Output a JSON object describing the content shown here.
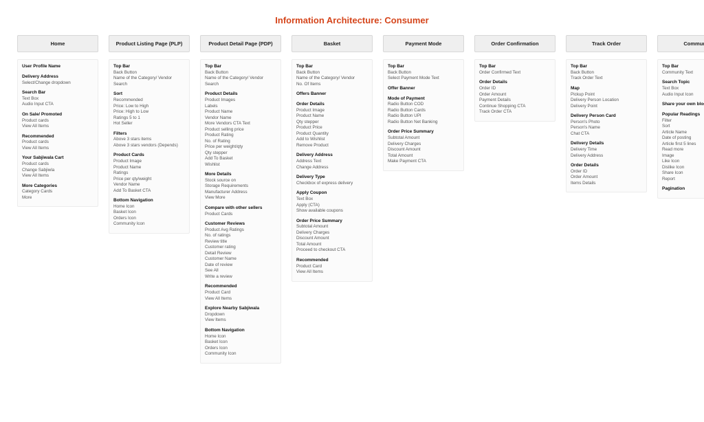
{
  "title": "Information Architecture: Consumer",
  "columns": [
    {
      "name": "home",
      "header": "Home",
      "groups": [
        {
          "title": "User Profile Name",
          "items": []
        },
        {
          "title": "Delivery Address",
          "items": [
            "Select/Change dropdown"
          ]
        },
        {
          "title": "Search Bar",
          "items": [
            "Text Box",
            "Audio Input CTA"
          ]
        },
        {
          "title": "On Sale/ Promoted",
          "items": [
            "Product cards",
            "View All Items"
          ]
        },
        {
          "title": "Recommended",
          "items": [
            "Product cards",
            "View All Items"
          ]
        },
        {
          "title": "Your Sabjiwala Cart",
          "items": [
            "Product cards",
            "Change Sabjiwla",
            "View All Items"
          ]
        },
        {
          "title": "More Categories",
          "items": [
            "Category Cards",
            "More"
          ]
        }
      ]
    },
    {
      "name": "plp",
      "header": "Product Listing Page (PLP)",
      "groups": [
        {
          "title": "Top Bar",
          "items": [
            "Back Button",
            "Name of the Category/ Vendor",
            "Search"
          ]
        },
        {
          "title": "Sort",
          "items": [
            "Recommended",
            "Price: Low to High",
            "Price: High to Low",
            "Ratings 5 to 1",
            "Hot Seller"
          ]
        },
        {
          "title": "Filters",
          "items": [
            "Above 3 stars items",
            "Above 3 stars vendors (Depends)"
          ]
        },
        {
          "title": "Product Cards",
          "items": [
            "Product Image",
            "Product Name",
            "Ratings",
            "Price per qty/weight",
            "Vendor Name",
            "Add To Basket CTA"
          ]
        },
        {
          "title": "Bottom Navigation",
          "items": [
            "Home Icon",
            "Basket Icon",
            "Orders Icon",
            "Community Icon"
          ]
        }
      ]
    },
    {
      "name": "pdp",
      "header": "Product Detail Page (PDP)",
      "groups": [
        {
          "title": "Top Bar",
          "items": [
            "Back Button",
            "Name of the Category/ Vendor",
            "Search"
          ]
        },
        {
          "title": "Product Details",
          "items": [
            "Product Images",
            "Labels",
            "Product Name",
            "Vendor Name",
            "More Vendors CTA Text",
            "Product selling price",
            "Product Rating",
            "No. of Rating",
            "Price per weight/qty",
            "Qty stepper",
            "Add To Basket",
            "Wishlist"
          ]
        },
        {
          "title": "More Details",
          "items": [
            "Stock source on",
            "Storage Requirements",
            "Manufacturer Address",
            "View More"
          ]
        },
        {
          "title": "Compare with other sellers",
          "items": [
            "Product Cards"
          ]
        },
        {
          "title": "Customer Reviews",
          "items": [
            "Product Avg Ratings",
            "No. of ratings",
            "Review title",
            "Customer rating",
            "Detail Review",
            "Customer Name",
            "Date of review",
            "See All",
            "Write a review"
          ]
        },
        {
          "title": "Recommended",
          "items": [
            "Product Card",
            "View All Items"
          ]
        },
        {
          "title": "Explore Nearby Sabjiwala",
          "items": [
            "Dropdown",
            "View Items"
          ]
        },
        {
          "title": "Bottom Navigation",
          "items": [
            "Home Icon",
            "Basket Icon",
            "Orders Icon",
            "Community Icon"
          ]
        }
      ]
    },
    {
      "name": "basket",
      "header": "Basket",
      "groups": [
        {
          "title": "Top Bar",
          "items": [
            "Back Button",
            "Name of the Category/ Vendor",
            "No. Of Items"
          ]
        },
        {
          "title": "Offers Banner",
          "items": []
        },
        {
          "title": "Order Details",
          "items": [
            "Product Image",
            "Product Name",
            "Qty stepper",
            "Product Price",
            "Product Quantity",
            "Add to Wishlist",
            "Remove Product"
          ]
        },
        {
          "title": "Delivery Address",
          "items": [
            "Address Text",
            "Change Address"
          ]
        },
        {
          "title": "Delivery Type",
          "items": [
            "Checkbox of express delivery"
          ]
        },
        {
          "title": "Apply Coupon",
          "items": [
            "Text Box",
            "Apply (CTA)",
            "Show available coupons"
          ]
        },
        {
          "title": "Order Price Summary",
          "items": [
            "Subtotal Amount",
            "Delivery Charges",
            "Discount Amount",
            "Total Amount",
            "Proceed to checkout CTA"
          ]
        },
        {
          "title": "Recommended",
          "items": [
            "Product Card",
            "View All Items"
          ]
        }
      ]
    },
    {
      "name": "payment",
      "header": "Payment Mode",
      "groups": [
        {
          "title": "Top Bar",
          "items": [
            "Back Button",
            "Select Payment Mode Text"
          ]
        },
        {
          "title": "Offer Banner",
          "items": []
        },
        {
          "title": "Mode of Payment",
          "items": [
            "Radio Button COD",
            "Radio Button Cards",
            "Radio Button UPI",
            "Radio Button Net Banking"
          ]
        },
        {
          "title": "Order Price Summary",
          "items": [
            "Subtotal Amount",
            "Delivery Charges",
            "Discount Amount",
            "Total Amount",
            "Make Payment CTA"
          ]
        }
      ]
    },
    {
      "name": "confirmation",
      "header": "Order Confirmation",
      "groups": [
        {
          "title": "Top Bar",
          "items": [
            "Order Confirmed Text"
          ]
        },
        {
          "title": "Order Details",
          "items": [
            "Order ID",
            "Order Amount",
            "Payment Details",
            "Continue Shopping CTA",
            "Track Order CTA"
          ]
        }
      ]
    },
    {
      "name": "track",
      "header": "Track Order",
      "groups": [
        {
          "title": "Top Bar",
          "items": [
            "Back Button",
            "Track Order Text"
          ]
        },
        {
          "title": "Map",
          "items": [
            "Pickup Point",
            "Delivery Person Location",
            "Delivery Point"
          ]
        },
        {
          "title": "Delivery Person Card",
          "items": [
            "Person's Photo",
            "Person's Name",
            "Chat CTA"
          ]
        },
        {
          "title": "Delivery Details",
          "items": [
            "Delivery Time",
            "Delivery Address"
          ]
        },
        {
          "title": "Order Details",
          "items": [
            "Order ID",
            "Order Amount",
            "Items Details"
          ]
        }
      ]
    },
    {
      "name": "community",
      "header": "Community",
      "groups": [
        {
          "title": "Top Bar",
          "items": [
            "Community Text"
          ]
        },
        {
          "title": "Search Topic",
          "items": [
            "Text Box",
            "Audio Input Icon"
          ]
        },
        {
          "title": "Share your own blog",
          "items": []
        },
        {
          "title": "Popular Readings",
          "items": [
            "Filter",
            "Sort",
            "Article Name",
            "Date of posting",
            "Article first 5 lines",
            "Read more",
            "Image",
            "Like Icon",
            "Dislike Icon",
            "Share Icon",
            "Report"
          ]
        },
        {
          "title": "Pagination",
          "items": []
        }
      ]
    }
  ]
}
